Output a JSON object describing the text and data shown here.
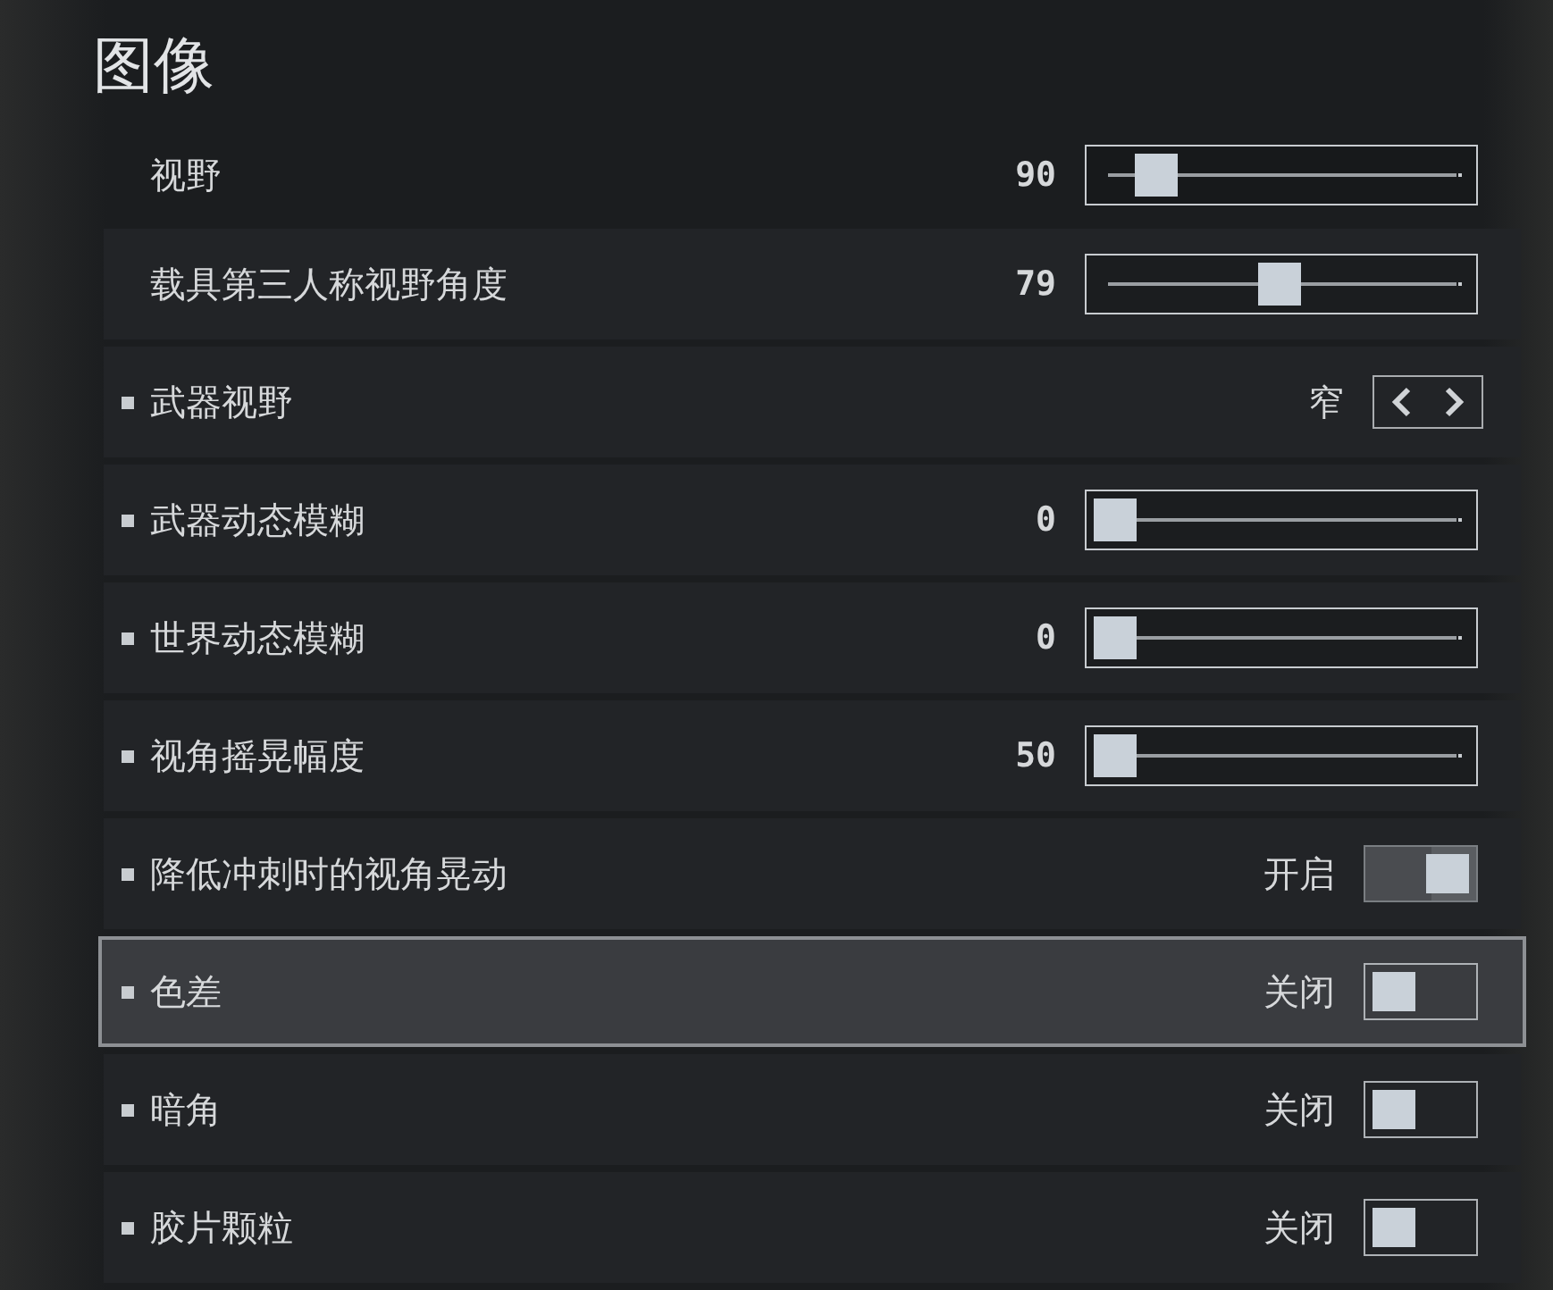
{
  "title": "图像",
  "rows": [
    {
      "kind": "slider",
      "label": "视野",
      "bullet": false,
      "selected": false,
      "value": "90",
      "level": 0.12
    },
    {
      "kind": "slider",
      "label": "载具第三人称视野角度",
      "bullet": false,
      "selected": false,
      "value": "79",
      "level": 0.49
    },
    {
      "kind": "selector",
      "label": "武器视野",
      "bullet": true,
      "selected": false,
      "value": "窄"
    },
    {
      "kind": "slider",
      "label": "武器动态模糊",
      "bullet": true,
      "selected": false,
      "value": "0",
      "level": 0
    },
    {
      "kind": "slider",
      "label": "世界动态模糊",
      "bullet": true,
      "selected": false,
      "value": "0",
      "level": 0
    },
    {
      "kind": "slider",
      "label": "视角摇晃幅度",
      "bullet": true,
      "selected": false,
      "value": "50",
      "level": 0
    },
    {
      "kind": "toggle",
      "label": "降低冲刺时的视角晃动",
      "bullet": true,
      "selected": false,
      "value": "开启",
      "on": true
    },
    {
      "kind": "toggle",
      "label": "色差",
      "bullet": true,
      "selected": true,
      "value": "关闭",
      "on": false
    },
    {
      "kind": "toggle",
      "label": "暗角",
      "bullet": true,
      "selected": false,
      "value": "关闭",
      "on": false
    },
    {
      "kind": "toggle",
      "label": "胶片颗粒",
      "bullet": true,
      "selected": false,
      "value": "关闭",
      "on": false
    }
  ]
}
